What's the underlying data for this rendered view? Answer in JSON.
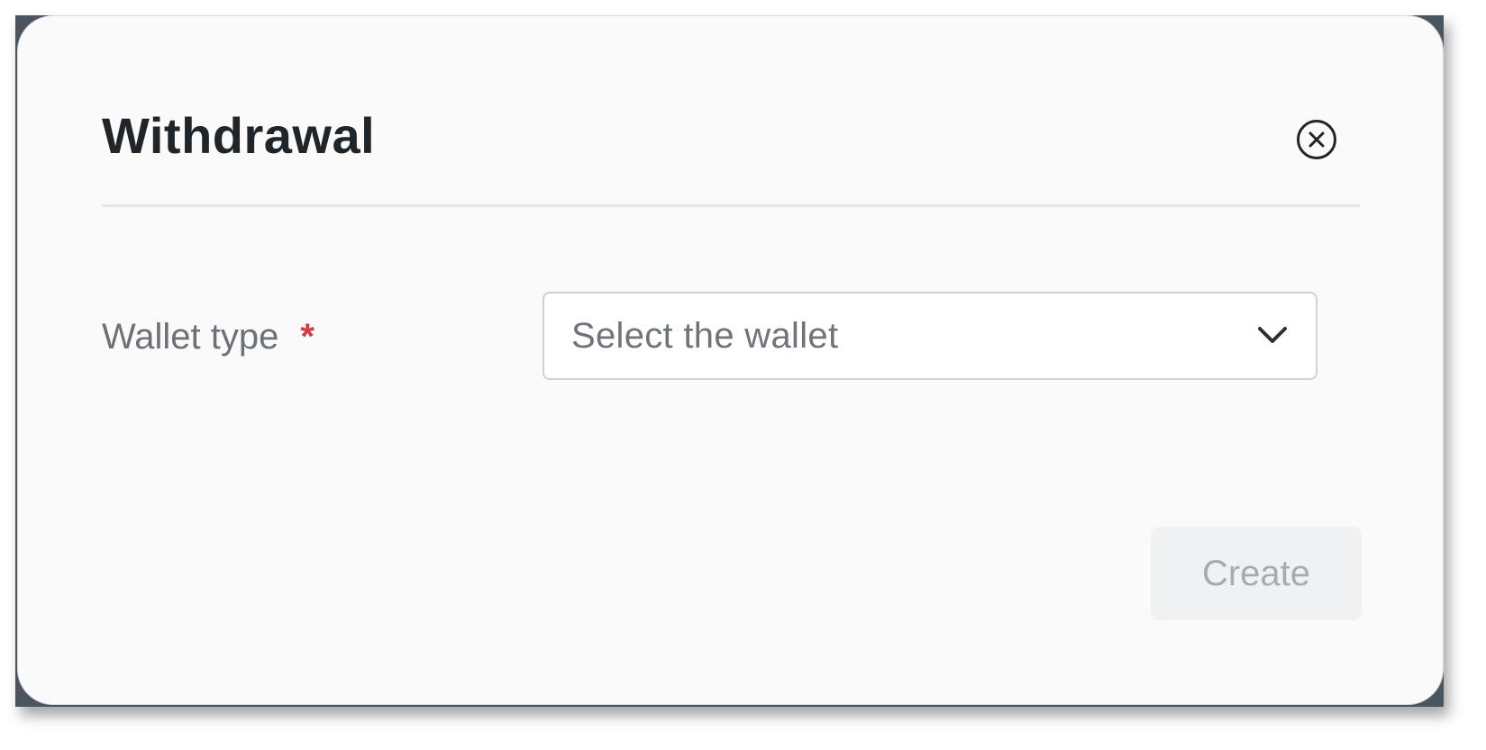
{
  "modal": {
    "title": "Withdrawal",
    "close_icon": "close-circle-icon"
  },
  "form": {
    "wallet_type": {
      "label": "Wallet type",
      "required_marker": "*",
      "placeholder": "Select the wallet",
      "chevron_icon": "chevron-down-icon"
    }
  },
  "actions": {
    "create_label": "Create",
    "create_disabled": true
  },
  "colors": {
    "required": "#d63a45",
    "backdrop": "#4b5560",
    "modal_bg": "#fafafa"
  }
}
